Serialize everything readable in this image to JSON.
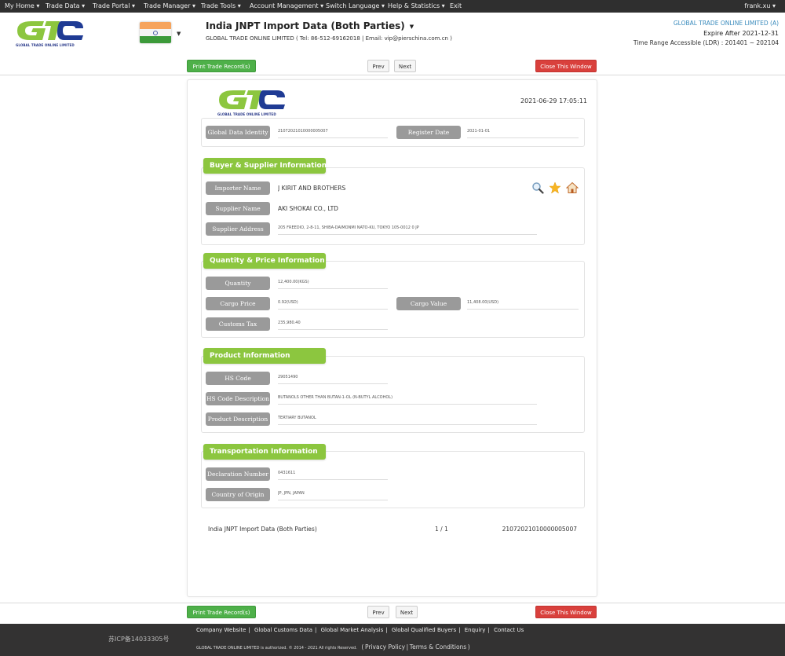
{
  "topnav": {
    "items": [
      "My Home",
      "Trade Data",
      "Trade Portal",
      "Trade Manager",
      "Trade Tools",
      "Account Management",
      "Switch Language",
      "Help & Statistics",
      "Exit"
    ],
    "user": "frank.xu"
  },
  "header": {
    "logo_text": "GLOBAL TRADE ONLINE LIMITED",
    "country_flag": "india-flag",
    "title": "India JNPT Import Data (Both Parties)",
    "subtitle": "GLOBAL TRADE ONLINE LIMITED ( Tel: 86-512-69162018 | Email: vip@pierschina.com.cn )",
    "company": "GLOBAL TRADE ONLINE LIMITED (A)",
    "expire": "Expire After 2021-12-31",
    "time_range": "Time Range Accessible (LDR) : 201401 ~ 202104"
  },
  "toolbar": {
    "print_label": "Print Trade Record(s)",
    "prev_label": "Prev",
    "next_label": "Next",
    "close_label": "Close This Window"
  },
  "record": {
    "timestamp": "2021-06-29 17:05:11",
    "identity": {
      "global_data_identity_label": "Global Data Identity",
      "global_data_identity": "21072021010000005007",
      "register_date_label": "Register Date",
      "register_date": "2021-01-01"
    },
    "buyer_supplier": {
      "title": "Buyer & Supplier Information",
      "importer_name_label": "Importer Name",
      "importer_name": "J KIRIT AND BROTHERS",
      "supplier_name_label": "Supplier Name",
      "supplier_name": "AKI SHOKAI CO., LTD",
      "supplier_address_label": "Supplier Address",
      "supplier_address": "205 FREEDIO, 2-8-11, SHIBA-DAIMONMI NATO-KU, TOKYO 105-0012 0 JP",
      "icons": [
        "search-icon",
        "star-icon",
        "home-icon"
      ]
    },
    "quantity_price": {
      "title": "Quantity & Price Information",
      "quantity_label": "Quantity",
      "quantity": "12,400.00(KGS)",
      "cargo_price_label": "Cargo Price",
      "cargo_price": "0.92(USD)",
      "cargo_value_label": "Cargo Value",
      "cargo_value": "11,408.00(USD)",
      "customs_tax_label": "Customs Tax",
      "customs_tax": "235,980.40"
    },
    "product": {
      "title": "Product Information",
      "hs_code_label": "HS Code",
      "hs_code": "29051490",
      "hs_desc_label": "HS Code Description",
      "hs_desc": "BUTANOLS OTHER THAN BUTAN-1-OL (N-BUTYL ALCOHOL)",
      "product_desc_label": "Product Description",
      "product_desc": "TERTIARY BUTANOL"
    },
    "transportation": {
      "title": "Transportation Information",
      "declaration_number_label": "Declaration Number",
      "declaration_number": "0431611",
      "country_origin_label": "Country of Origin",
      "country_origin": "JP, JPN, JAPAN"
    },
    "summary": {
      "dataset": "India JNPT Import Data (Both Parties)",
      "page": "1 / 1",
      "id": "21072021010000005007"
    }
  },
  "footer": {
    "icp": "苏ICP备14033305号",
    "links": [
      "Company Website",
      "Global Customs Data",
      "Global Market Analysis",
      "Global Qualified Buyers",
      "Enquiry",
      "Contact Us"
    ],
    "copyright": "GLOBAL TRADE ONLINE LIMITED is authorized. © 2014 - 2021 All rights Reserved.",
    "privacy_label": "Privacy Policy",
    "terms_label": "Terms & Conditions"
  },
  "colors": {
    "accent_green": "#8cc63f",
    "button_green": "#4eb049",
    "button_red": "#d9403c",
    "label_gray": "#9a9a9a",
    "company_blue": "#3a8bbd"
  }
}
